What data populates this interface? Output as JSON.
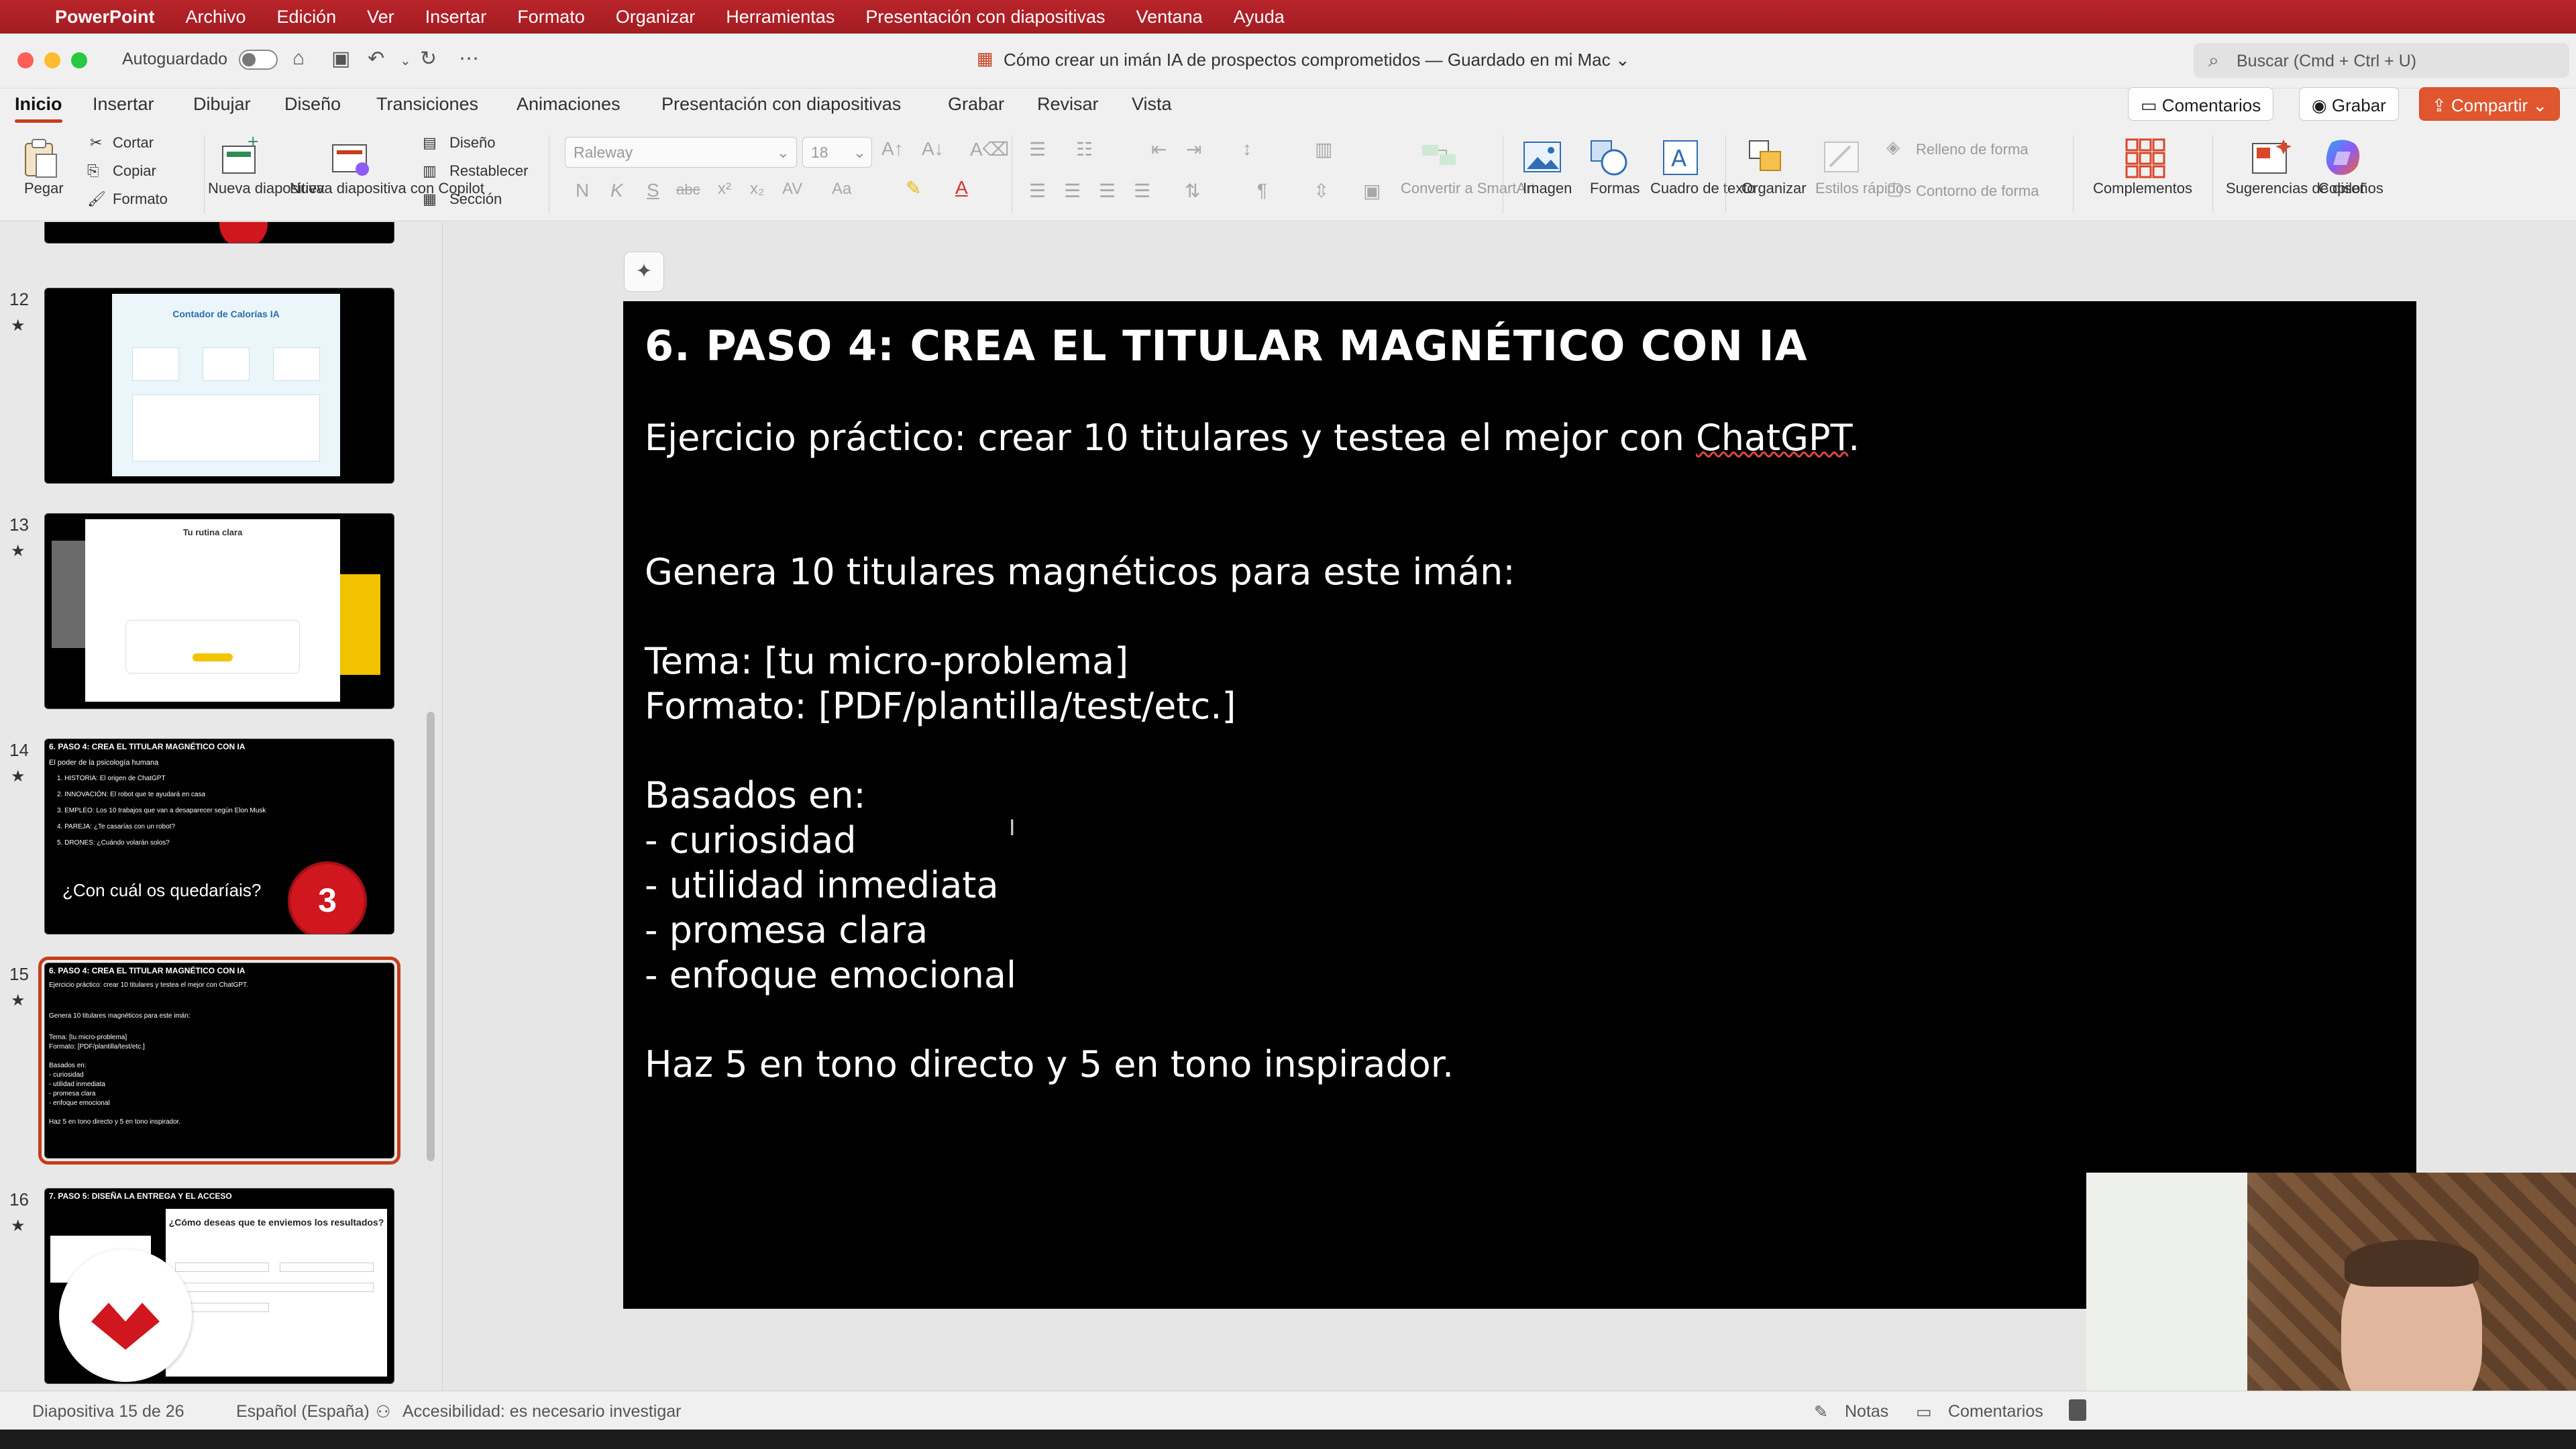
{
  "menubar": {
    "app": "PowerPoint",
    "items": [
      "Archivo",
      "Edición",
      "Ver",
      "Insertar",
      "Formato",
      "Organizar",
      "Herramientas",
      "Presentación con diapositivas",
      "Ventana",
      "Ayuda"
    ]
  },
  "titlebar": {
    "autosave_label": "Autoguardado",
    "doc_title": "Cómo crear un imán IA de prospectos comprometidos — Guardado en mi Mac ⌄",
    "search_placeholder": "Buscar (Cmd + Ctrl + U)"
  },
  "tabs": [
    "Inicio",
    "Insertar",
    "Dibujar",
    "Diseño",
    "Transiciones",
    "Animaciones",
    "Presentación con diapositivas",
    "Grabar",
    "Revisar",
    "Vista"
  ],
  "tab_actions": {
    "comments": "Comentarios",
    "record": "Grabar",
    "share": "Compartir"
  },
  "ribbon": {
    "paste": "Pegar",
    "cut": "Cortar",
    "copy": "Copiar",
    "format": "Formato",
    "new_slide": "Nueva diapositiva",
    "new_slide_copilot": "Nueva diapositiva con Copilot",
    "layout": "Diseño",
    "reset": "Restablecer",
    "section": "Sección",
    "font_name": "Raleway",
    "font_size": "18",
    "convert_smartart": "Convertir a SmartArt",
    "image": "Imagen",
    "shapes": "Formas",
    "textbox": "Cuadro de texto",
    "arrange": "Organizar",
    "quick_styles": "Estilos rápidos",
    "shape_fill": "Relleno de forma",
    "shape_outline": "Contorno de forma",
    "addins": "Complementos",
    "design_ideas": "Sugerencias de diseños",
    "copilot": "Copilot",
    "fmt_glyphs": [
      "N",
      "K",
      "S",
      "abc",
      "x²",
      "x₂",
      "AV",
      "Aa"
    ]
  },
  "thumbnails": [
    {
      "num": "12",
      "title": "Contador de Calorías IA"
    },
    {
      "num": "13",
      "title": "Tu rutina clara"
    },
    {
      "num": "14",
      "title": "6. PASO 4: CREA EL TITULAR MAGNÉTICO CON IA",
      "subtitle": "El poder de la psicología humana",
      "lines": [
        "1. HISTORIA: El origen de ChatGPT",
        "2. INNOVACIÓN: El robot que te ayudará en casa",
        "3. EMPLEO: Los 10 trabajos que van a desaparecer según Elon Musk",
        "4. PAREJA: ¿Te casarías con un robot?",
        "5. DRONES: ¿Cuándo volarán solos?"
      ],
      "question": "¿Con cuál os quedaríais?",
      "badge": "3"
    },
    {
      "num": "15",
      "title": "6. PASO 4: CREA EL TITULAR MAGNÉTICO CON IA",
      "lines": [
        "Ejercicio práctico: crear 10 titulares y testea el mejor con ChatGPT.",
        "",
        "Genera 10 titulares magnéticos para este imán:",
        "",
        "Tema: [tu micro-problema]",
        "Formato: [PDF/plantilla/test/etc.]",
        "",
        "Basados en:",
        "- curiosidad",
        "- utilidad inmediata",
        "- promesa clara",
        "- enfoque emocional",
        "",
        "Haz 5 en tono directo y 5 en tono inspirador."
      ]
    },
    {
      "num": "16",
      "title": "7. PASO 5: DISEÑA LA ENTREGA Y EL ACCESO",
      "question": "¿Cómo deseas que te enviemos los resultados?"
    }
  ],
  "slide": {
    "title": "6. PASO 4: CREA EL TITULAR MAGNÉTICO CON IA",
    "line1_pre": "Ejercicio práctico: crear 10 titulares y testea el mejor con ",
    "line1_link": "ChatGPT",
    "line1_post": ".",
    "line2": "Genera 10 titulares magnéticos para este imán:",
    "line3": "Tema: [tu micro-problema]",
    "line4": "Formato: [PDF/plantilla/test/etc.]",
    "line5": "Basados en:",
    "bullets": [
      "- curiosidad",
      "- utilidad inmediata",
      "- promesa clara",
      "- enfoque emocional"
    ],
    "closing": "Haz 5 en tono directo y 5 en tono inspirador."
  },
  "status": {
    "slide_count": "Diapositiva 15 de 26",
    "language": "Español (España)",
    "accessibility": "Accesibilidad: es necesario investigar",
    "notes": "Notas",
    "comments": "Comentarios"
  },
  "colors": {
    "menubar": "#b8242a",
    "accent": "#c43e1c",
    "share": "#e0562e",
    "badge": "#d0161e"
  }
}
